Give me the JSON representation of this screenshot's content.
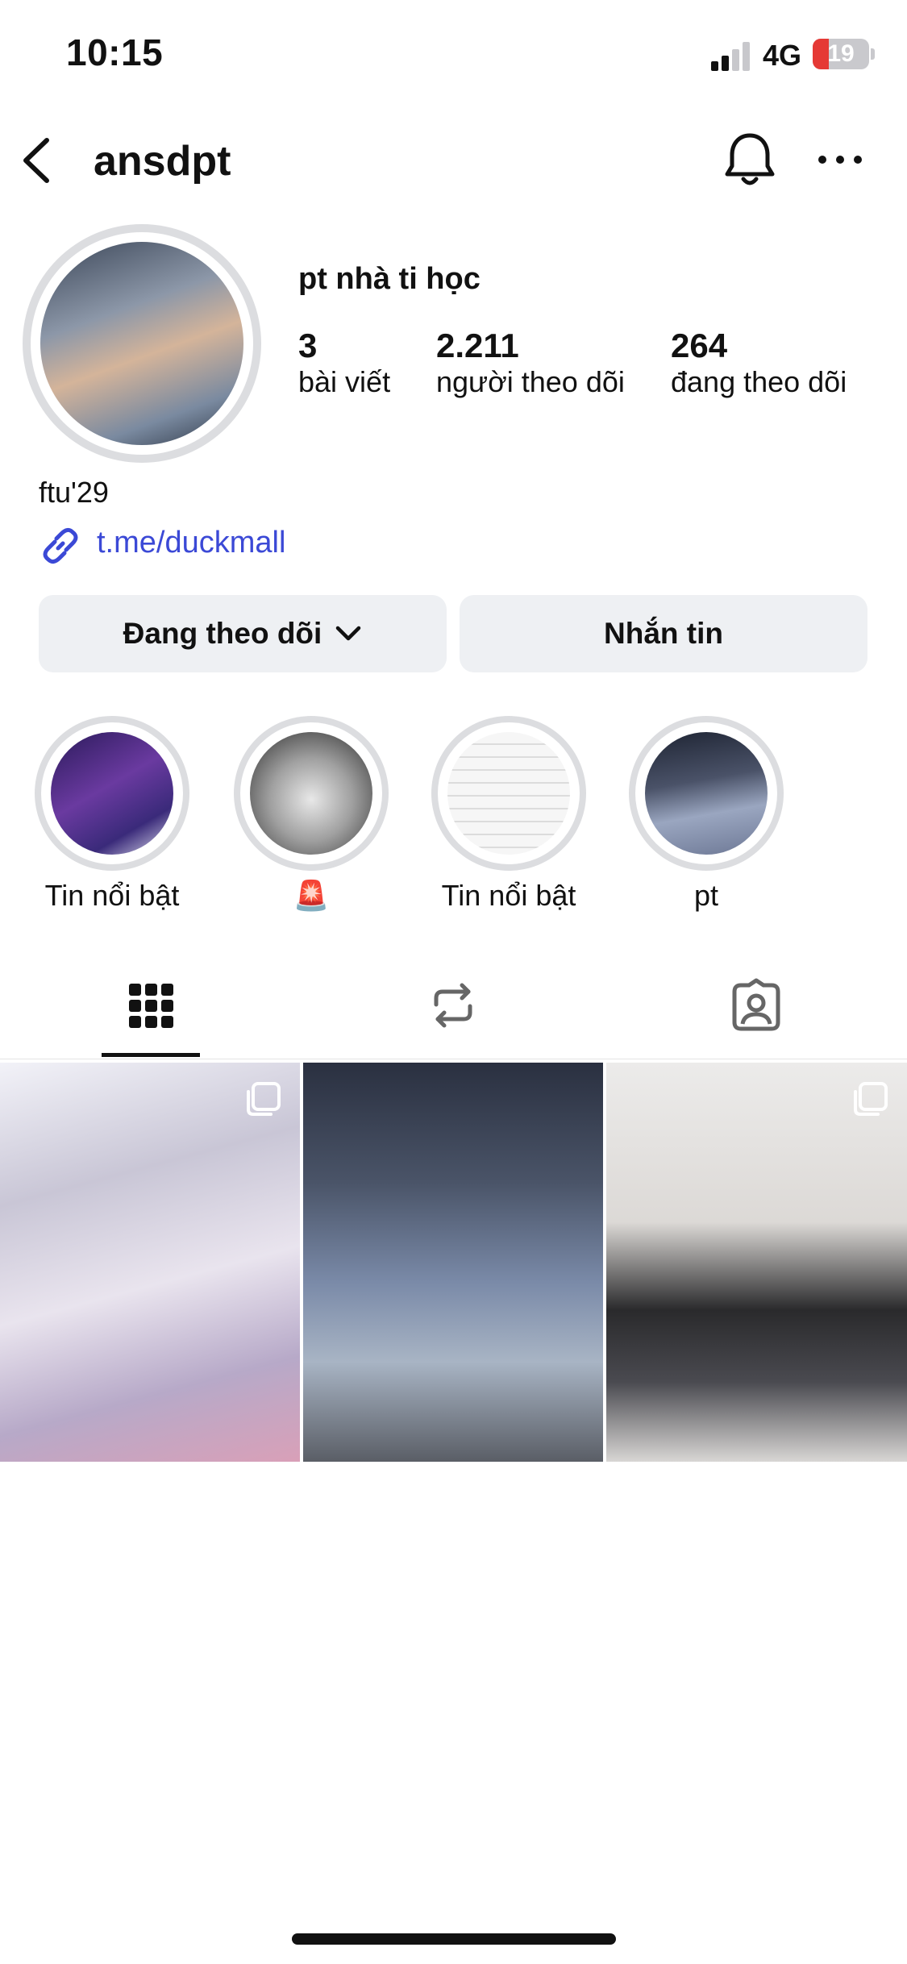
{
  "status_bar": {
    "time": "10:15",
    "network": "4G",
    "battery": "19",
    "battery_color": "#e53935"
  },
  "header": {
    "username": "ansdpt",
    "back_icon": "chevron-left-icon",
    "bell_icon": "bell-icon",
    "more_icon": "more-horizontal-icon"
  },
  "profile": {
    "display_name": "pt nhà ti học",
    "stats": [
      {
        "value": "3",
        "label": "bài viết"
      },
      {
        "value": "2.211",
        "label": "người theo dõi"
      },
      {
        "value": "264",
        "label": "đang theo dõi"
      }
    ],
    "bio": "ftu'29",
    "link": "t.me/duckmall",
    "link_color": "#3b49d6"
  },
  "buttons": {
    "following": "Đang theo dõi",
    "message": "Nhắn tin"
  },
  "highlights": [
    {
      "label": "Tin nổi bật"
    },
    {
      "label": "🚨"
    },
    {
      "label": "Tin nổi bật"
    },
    {
      "label": "pt"
    }
  ],
  "tabs": [
    {
      "name": "grid-icon",
      "active": true
    },
    {
      "name": "repost-icon",
      "active": false
    },
    {
      "name": "tagged-icon",
      "active": false
    }
  ],
  "posts": [
    {
      "multi": true
    },
    {
      "multi": false
    },
    {
      "multi": true
    }
  ]
}
